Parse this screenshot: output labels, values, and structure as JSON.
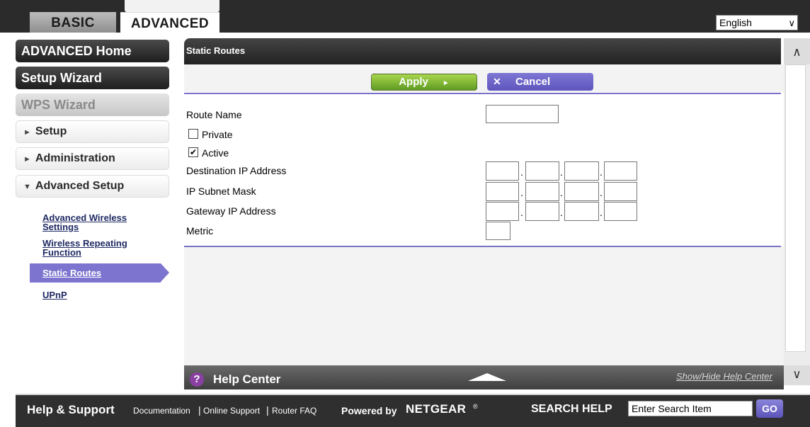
{
  "tabs": {
    "basic": "BASIC",
    "advanced": "ADVANCED"
  },
  "language": {
    "selected": "English"
  },
  "nav": {
    "advanced_home": "ADVANCED Home",
    "setup_wizard": "Setup Wizard",
    "wps_wizard": "WPS Wizard",
    "setup": "Setup",
    "administration": "Administration",
    "advanced_setup": "Advanced Setup",
    "sub_items": [
      "Advanced Wireless Settings",
      "Wireless Repeating Function",
      "Static Routes",
      "UPnP"
    ],
    "sub_line1": "Advanced Wireless",
    "sub_line2": "Settings",
    "sub2_line1": "Wireless Repeating",
    "sub2_line2": "Function",
    "active": "Static Routes",
    "upnp": "UPnP"
  },
  "panel": {
    "title": "Static Routes",
    "apply": "Apply",
    "cancel": "Cancel"
  },
  "form": {
    "route_name": "Route Name",
    "private": "Private",
    "private_checked": false,
    "active": "Active",
    "active_checked": true,
    "destination_ip": "Destination IP Address",
    "subnet_mask": "IP Subnet Mask",
    "gateway_ip": "Gateway IP Address",
    "metric": "Metric",
    "ip_separator": "."
  },
  "help": {
    "title": "Help Center",
    "toggle": "Show/Hide Help Center"
  },
  "footer": {
    "title": "Help & Support",
    "links": [
      "Documentation",
      "Online Support",
      "Router FAQ"
    ],
    "separator": "|",
    "powered_by": "Powered by",
    "brand": "NETGEAR",
    "registered": "®",
    "search_label": "SEARCH HELP",
    "search_placeholder": "Enter Search Item",
    "go": "GO"
  },
  "colors": {
    "accent_purple": "#7d74cf",
    "apply_green": "#6fae2c",
    "dark_bar": "#2b2b2b"
  }
}
